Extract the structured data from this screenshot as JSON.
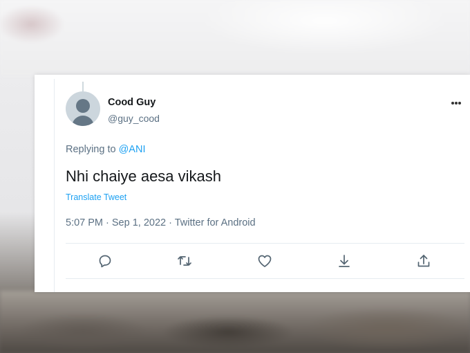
{
  "tweet": {
    "display_name": "Cood Guy",
    "handle": "@guy_cood",
    "replying_prefix": "Replying to",
    "replying_to": "@ANI",
    "text": "Nhi chaiye aesa vikash",
    "translate_label": "Translate Tweet",
    "timestamp": "5:07 PM · Sep 1, 2022 · Twitter for Android"
  },
  "icons": {
    "more": "more-horizontal-icon",
    "reply": "reply-icon",
    "retweet": "retweet-icon",
    "like": "heart-icon",
    "download": "download-icon",
    "share": "share-icon"
  },
  "colors": {
    "accent": "#1da1f2",
    "secondary_text": "#5b7083",
    "primary_text": "#14171a"
  }
}
